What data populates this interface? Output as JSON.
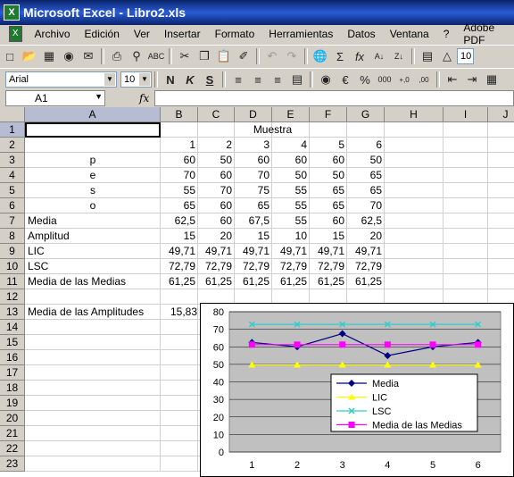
{
  "window": {
    "title": "Microsoft Excel - Libro2.xls"
  },
  "menu": [
    "Archivo",
    "Edición",
    "Ver",
    "Insertar",
    "Formato",
    "Herramientas",
    "Datos",
    "Ventana",
    "?",
    "Adobe PDF"
  ],
  "format_bar": {
    "font": "Arial",
    "size": "10",
    "zoom_partial": "10"
  },
  "formula_bar": {
    "cell_ref": "A1",
    "fx": "fx",
    "content": ""
  },
  "columns": [
    "A",
    "B",
    "C",
    "D",
    "E",
    "F",
    "G",
    "H",
    "I",
    "J"
  ],
  "rows": [
    "1",
    "2",
    "3",
    "4",
    "5",
    "6",
    "7",
    "8",
    "9",
    "10",
    "11",
    "12",
    "13",
    "14",
    "15",
    "16",
    "17",
    "18",
    "19",
    "20",
    "21",
    "22",
    "23"
  ],
  "sheet": {
    "header_muestra": "Muestra",
    "sample_numbers": [
      "1",
      "2",
      "3",
      "4",
      "5",
      "6"
    ],
    "peso_letters": [
      "p",
      "e",
      "s",
      "o"
    ],
    "weights": [
      [
        "60",
        "50",
        "60",
        "60",
        "60",
        "50"
      ],
      [
        "70",
        "60",
        "70",
        "50",
        "50",
        "65"
      ],
      [
        "55",
        "70",
        "75",
        "55",
        "65",
        "65"
      ],
      [
        "65",
        "60",
        "65",
        "55",
        "65",
        "70"
      ]
    ],
    "labeled_rows": [
      {
        "label": "Media",
        "values": [
          "62,5",
          "60",
          "67,5",
          "55",
          "60",
          "62,5"
        ]
      },
      {
        "label": "Amplitud",
        "values": [
          "15",
          "20",
          "15",
          "10",
          "15",
          "20"
        ]
      },
      {
        "label": "LIC",
        "values": [
          "49,71",
          "49,71",
          "49,71",
          "49,71",
          "49,71",
          "49,71"
        ]
      },
      {
        "label": "LSC",
        "values": [
          "72,79",
          "72,79",
          "72,79",
          "72,79",
          "72,79",
          "72,79"
        ]
      },
      {
        "label": "Media de las Medias",
        "values": [
          "61,25",
          "61,25",
          "61,25",
          "61,25",
          "61,25",
          "61,25"
        ]
      }
    ],
    "amplitudes_label": "Media de las Amplitudes",
    "amplitudes_value": "15,83"
  },
  "chart_data": {
    "type": "line",
    "x": [
      1,
      2,
      3,
      4,
      5,
      6
    ],
    "ylim": [
      0,
      80
    ],
    "yticks": [
      0,
      10,
      20,
      30,
      40,
      50,
      60,
      70,
      80
    ],
    "plot_background": "#c0c0c0",
    "grid": true,
    "legend_position": "inside-right",
    "series": [
      {
        "name": "Media",
        "values": [
          62.5,
          60,
          67.5,
          55,
          60,
          62.5
        ],
        "color": "#000080",
        "marker": "diamond"
      },
      {
        "name": "LIC",
        "values": [
          49.71,
          49.71,
          49.71,
          49.71,
          49.71,
          49.71
        ],
        "color": "#ffff00",
        "marker": "triangle"
      },
      {
        "name": "LSC",
        "values": [
          72.79,
          72.79,
          72.79,
          72.79,
          72.79,
          72.79
        ],
        "color": "#33cccc",
        "marker": "x"
      },
      {
        "name": "Media de las Medias",
        "values": [
          61.25,
          61.25,
          61.25,
          61.25,
          61.25,
          61.25
        ],
        "color": "#ff00ff",
        "marker": "square"
      }
    ]
  }
}
